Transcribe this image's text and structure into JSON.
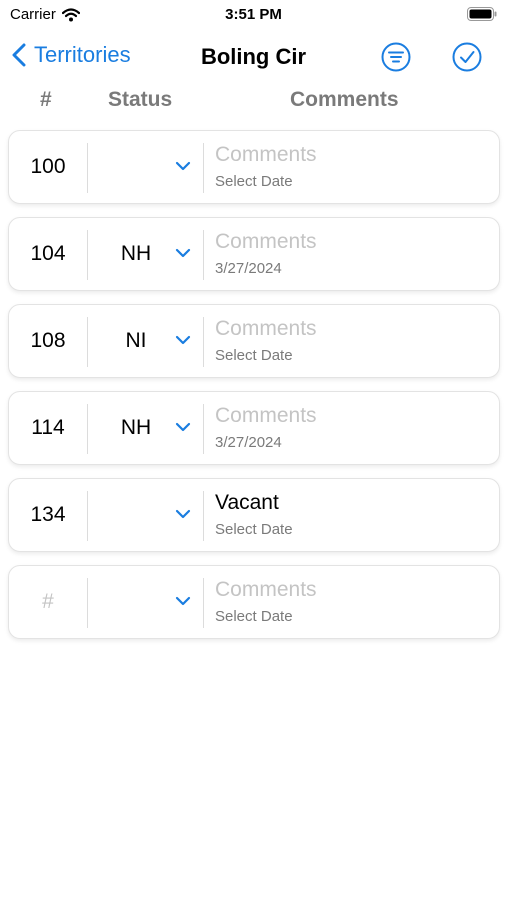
{
  "status_bar": {
    "carrier": "Carrier",
    "time": "3:51 PM"
  },
  "nav": {
    "back_label": "Territories",
    "title": "Boling Cir"
  },
  "columns": {
    "number": "#",
    "status": "Status",
    "comments": "Comments"
  },
  "rows": [
    {
      "number": "100",
      "status": "",
      "comment": "Comments",
      "comment_is_placeholder": true,
      "date": "Select Date"
    },
    {
      "number": "104",
      "status": "NH",
      "comment": "Comments",
      "comment_is_placeholder": true,
      "date": "3/27/2024"
    },
    {
      "number": "108",
      "status": "NI",
      "comment": "Comments",
      "comment_is_placeholder": true,
      "date": "Select Date"
    },
    {
      "number": "114",
      "status": "NH",
      "comment": "Comments",
      "comment_is_placeholder": true,
      "date": "3/27/2024"
    },
    {
      "number": "134",
      "status": "",
      "comment": "Vacant",
      "comment_is_placeholder": false,
      "date": "Select Date"
    },
    {
      "number": "#",
      "number_is_placeholder": true,
      "status": "",
      "comment": "Comments",
      "comment_is_placeholder": true,
      "date": "Select Date"
    }
  ],
  "colors": {
    "accent": "#1a7de0",
    "placeholder": "#c4c4c4",
    "secondary_text": "#7a7a7a"
  }
}
